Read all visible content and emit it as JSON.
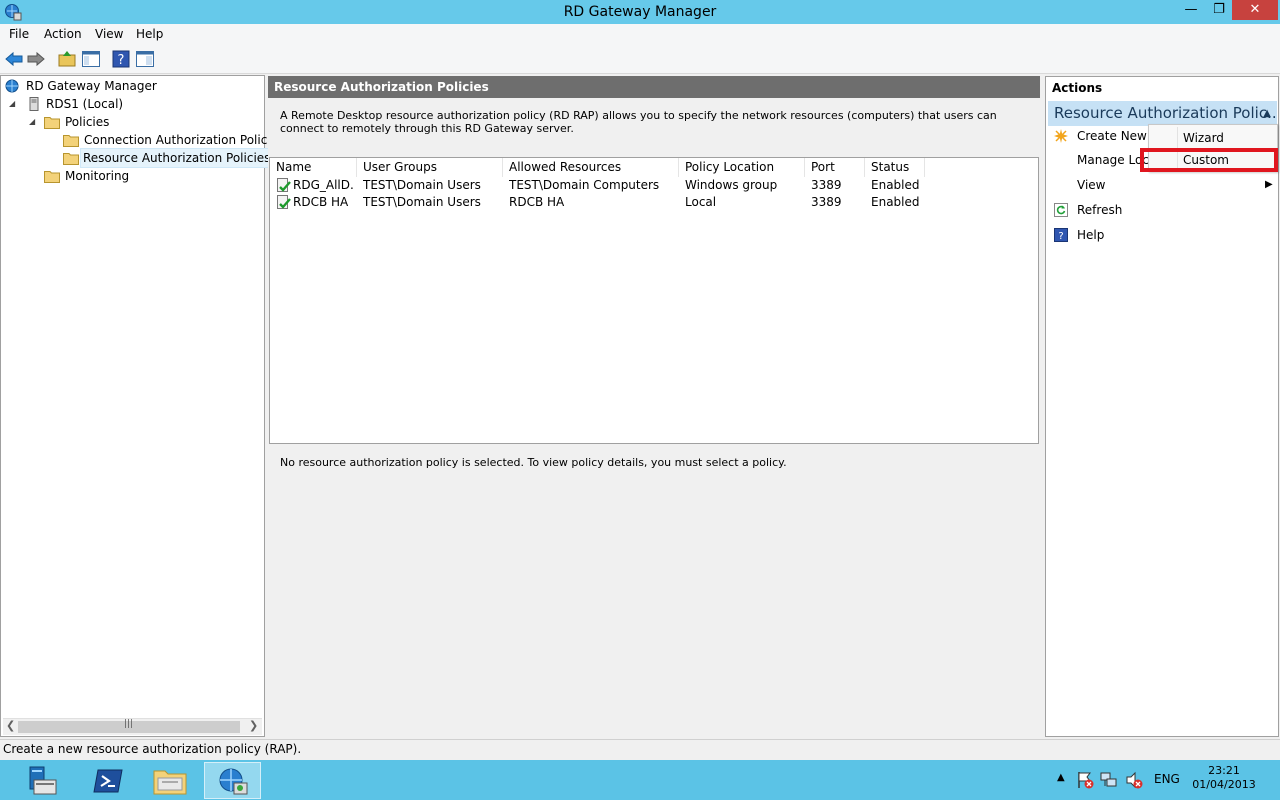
{
  "window": {
    "title": "RD Gateway Manager"
  },
  "menu": {
    "items": [
      "File",
      "Action",
      "View",
      "Help"
    ]
  },
  "tree": {
    "root": "RD Gateway Manager",
    "server": "RDS1 (Local)",
    "policies": "Policies",
    "cap": "Connection Authorization Policies",
    "rap": "Resource Authorization Policies",
    "monitoring": "Monitoring"
  },
  "main": {
    "header": "Resource Authorization Policies",
    "description": "A Remote Desktop resource authorization policy (RD RAP) allows you to specify the network resources (computers) that users can connect to remotely through this RD Gateway server.",
    "columns": [
      "Name",
      "User Groups",
      "Allowed Resources",
      "Policy Location",
      "Port",
      "Status"
    ],
    "rows": [
      [
        "RDG_AllD...",
        "TEST\\Domain Users",
        "TEST\\Domain Computers",
        "Windows group",
        "3389",
        "Enabled"
      ],
      [
        "RDCB HA",
        "TEST\\Domain Users",
        "RDCB HA",
        "Local",
        "3389",
        "Enabled"
      ]
    ],
    "details": "No resource authorization policy is selected. To view policy details, you must select a policy."
  },
  "actions": {
    "title": "Actions",
    "section": "Resource Authorization Polic...",
    "items": [
      "Create New P",
      "Manage Loca",
      "View",
      "Refresh",
      "Help"
    ],
    "submenu": [
      "Wizard",
      "Custom"
    ]
  },
  "status": {
    "text": "Create a new resource authorization policy (RAP)."
  },
  "tray": {
    "lang": "ENG",
    "time": "23:21",
    "date": "01/04/2013"
  },
  "colors": {
    "titlebar": "#66c9ea",
    "taskbar": "#5bc3e6",
    "highlight": "#e0161f",
    "close": "#c7423e"
  }
}
